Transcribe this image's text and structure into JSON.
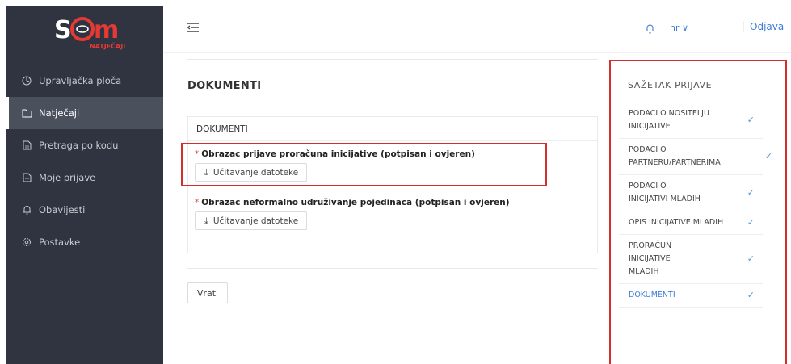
{
  "brand": {
    "logo_text": "NATJEČAJI",
    "accent": "#e53935"
  },
  "sidebar": {
    "items": [
      {
        "label": "Upravljačka ploča",
        "icon": "dashboard-icon",
        "active": false
      },
      {
        "label": "Natječaji",
        "icon": "folder-icon",
        "active": true
      },
      {
        "label": "Pretraga po kodu",
        "icon": "file-search-icon",
        "active": false
      },
      {
        "label": "Moje prijave",
        "icon": "file-icon",
        "active": false
      },
      {
        "label": "Obavijesti",
        "icon": "bell-icon",
        "active": false
      },
      {
        "label": "Postavke",
        "icon": "gear-icon",
        "active": false
      }
    ]
  },
  "header": {
    "language": "hr ∨",
    "logout": "Odjava"
  },
  "main": {
    "title": "DOKUMENTI",
    "card_title": "DOKUMENTI",
    "fields": [
      {
        "label": "Obrazac prijave proračuna inicijative (potpisan i ovjeren)",
        "required_mark": "*",
        "button": "Učitavanje datoteke"
      },
      {
        "label": "Obrazac neformalno udruživanje pojedinaca (potpisan i ovjeren)",
        "required_mark": "*",
        "button": "Učitavanje datoteke"
      }
    ],
    "back_button": "Vrati"
  },
  "summary": {
    "title": "SAŽETAK PRIJAVE",
    "items": [
      {
        "label": "PODACI O NOSITELJU INICIJATIVE",
        "check": "✓"
      },
      {
        "label": "PODACI O PARTNERU/PARTNERIMA",
        "check": "✓"
      },
      {
        "label": "PODACI O INICIJATIVI MLADIH",
        "check": "✓"
      },
      {
        "label": "OPIS INICIJATIVE MLADIH",
        "check": "✓"
      },
      {
        "label": "PRORAČUN INICIJATIVE MLADIH",
        "check": "✓"
      },
      {
        "label": "DOKUMENTI",
        "check": "✓"
      }
    ]
  }
}
